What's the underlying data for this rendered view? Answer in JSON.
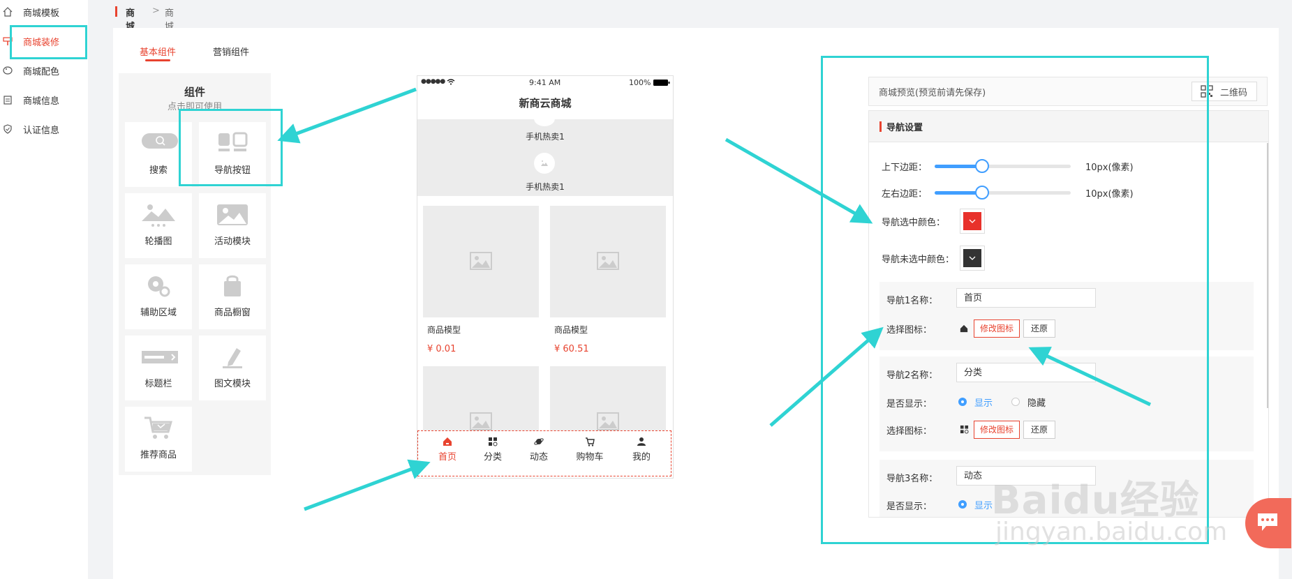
{
  "sidebar": {
    "items": [
      {
        "label": "商城模板",
        "icon": "home-icon"
      },
      {
        "label": "商城装修",
        "icon": "paint-icon",
        "active": true
      },
      {
        "label": "商城配色",
        "icon": "palette-icon"
      },
      {
        "label": "商城信息",
        "icon": "clipboard-icon"
      },
      {
        "label": "认证信息",
        "icon": "shield-icon"
      }
    ]
  },
  "breadcrumb": {
    "root": "商城",
    "sep": ">",
    "current": "商城装修"
  },
  "tabs": {
    "basic": "基本组件",
    "marketing": "营销组件"
  },
  "components": {
    "title": "组件",
    "subtitle": "点击即可使用",
    "items": [
      {
        "label": "搜索",
        "icon": "search-bar-icon"
      },
      {
        "label": "导航按钮",
        "icon": "nav-button-icon"
      },
      {
        "label": "轮播图",
        "icon": "carousel-icon"
      },
      {
        "label": "活动模块",
        "icon": "activity-image-icon"
      },
      {
        "label": "辅助区域",
        "icon": "tools-icon"
      },
      {
        "label": "商品橱窗",
        "icon": "shopping-bag-icon"
      },
      {
        "label": "标题栏",
        "icon": "title-bar-icon"
      },
      {
        "label": "图文模块",
        "icon": "edit-pen-icon"
      },
      {
        "label": "推荐商品",
        "icon": "cart-icon"
      }
    ]
  },
  "phone": {
    "status": {
      "signal": "●●●●●",
      "time": "9:41 AM",
      "battery": "100%"
    },
    "title": "新商云商城",
    "hot_items": [
      "手机热卖1",
      "手机热卖1"
    ],
    "products": [
      {
        "name": "商品模型",
        "price": "¥ 0.01"
      },
      {
        "name": "商品模型",
        "price": "¥ 60.51"
      }
    ],
    "tabbar": [
      {
        "label": "首页",
        "icon": "home-icon",
        "active": true
      },
      {
        "label": "分类",
        "icon": "grid-icon"
      },
      {
        "label": "动态",
        "icon": "planet-icon"
      },
      {
        "label": "购物车",
        "icon": "cart-icon"
      },
      {
        "label": "我的",
        "icon": "user-icon"
      }
    ]
  },
  "preview": {
    "label": "商城预览(预览前请先保存)",
    "qr_button": "二维码"
  },
  "settings": {
    "section_title": "导航设置",
    "margin_vertical": {
      "label": "上下边距：",
      "value": "10px(像素)",
      "level": 0.35
    },
    "margin_horizontal": {
      "label": "左右边距：",
      "value": "10px(像素)",
      "level": 0.35
    },
    "selected_color": {
      "label": "导航选中颜色：",
      "color": "#e8312b"
    },
    "unselected_color": {
      "label": "导航未选中颜色：",
      "color": "#333333"
    },
    "navs": [
      {
        "name_label": "导航1名称：",
        "name_value": "首页",
        "icon_label": "选择图标：",
        "icon": "home-icon",
        "modify": "修改图标",
        "restore": "还原"
      },
      {
        "name_label": "导航2名称：",
        "name_value": "分类",
        "show_label": "是否显示：",
        "show": "显示",
        "hide": "隐藏",
        "icon_label": "选择图标：",
        "icon": "grid-icon",
        "modify": "修改图标",
        "restore": "还原"
      },
      {
        "name_label": "导航3名称：",
        "name_value": "动态",
        "show_label": "是否显示：",
        "show": "显示"
      }
    ]
  },
  "watermark": {
    "logo": "Baidu经验",
    "url": "jingyan.baidu.com"
  },
  "colors": {
    "accent": "#e8432f",
    "highlight": "#2fd3d3",
    "blue": "#409eff"
  }
}
